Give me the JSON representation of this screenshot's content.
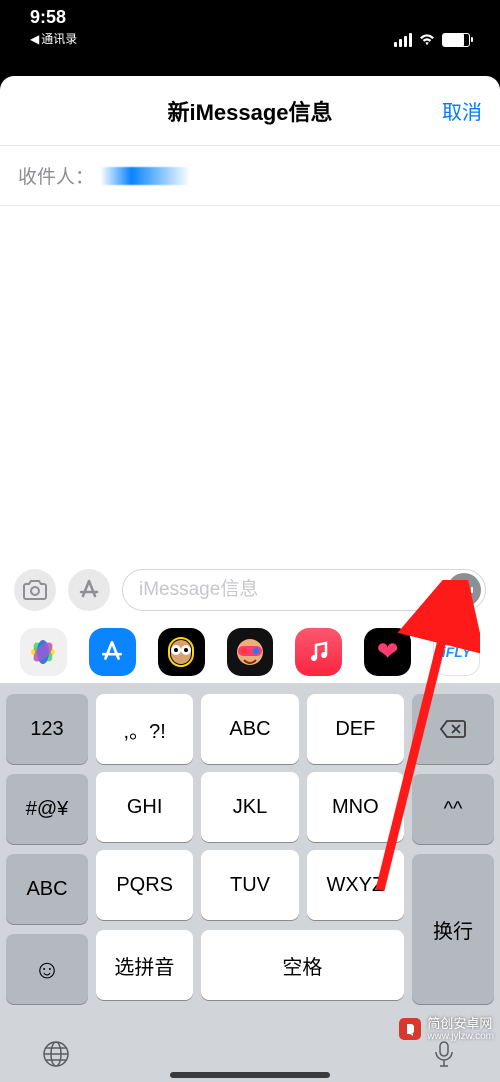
{
  "status": {
    "time": "9:58",
    "back": "通讯录"
  },
  "nav": {
    "title": "新iMessage信息",
    "cancel": "取消"
  },
  "to": {
    "label": "收件人："
  },
  "input": {
    "placeholder": "iMessage信息"
  },
  "apps": {
    "photos": "photos",
    "appstore": "A",
    "music": "♫",
    "heart": "❤",
    "ifly": "iFLY"
  },
  "keys": {
    "left": [
      "123",
      "#@¥",
      "ABC"
    ],
    "emoji": "☺",
    "mid_row1": [
      ",。?!",
      "ABC",
      "DEF"
    ],
    "mid_row2": [
      "GHI",
      "JKL",
      "MNO"
    ],
    "mid_row3": [
      "PQRS",
      "TUV",
      "WXYZ"
    ],
    "bottom": [
      "选拼音",
      "空格"
    ],
    "right_del": "⌫",
    "right_caret": "^^",
    "right_enter": "换行"
  },
  "watermark": {
    "name": "简创安卓网",
    "url": "www.jylzw.com"
  }
}
